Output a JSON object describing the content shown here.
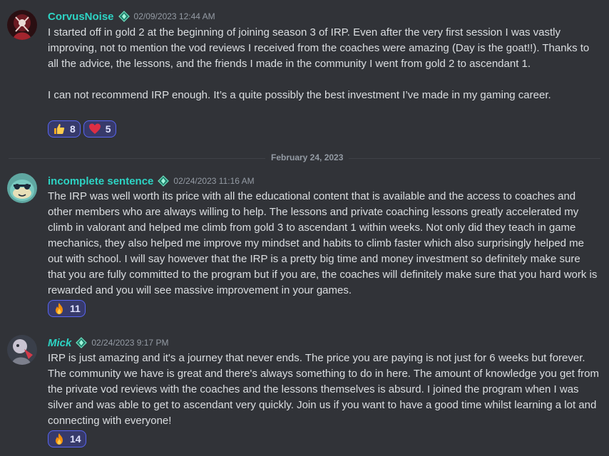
{
  "messages": [
    {
      "username": "CorvusNoise",
      "timestamp": "02/09/2023 12:44 AM",
      "text": "I started off in gold 2 at the beginning of joining season 3 of IRP. Even after the very first session I was vastly improving, not to mention the vod reviews I received from the coaches were amazing (Day is the goat!!). Thanks to all the advice, the lessons, and the friends I made in the community I went from gold 2 to ascendant 1.\n\nI can not recommend IRP enough. It’s a quite possibly the best investment I’ve made in my gaming career.",
      "reactions": [
        {
          "emoji": "thumbs-up",
          "count": "8"
        },
        {
          "emoji": "red-heart",
          "count": "5"
        }
      ]
    },
    {
      "username": "incomplete sentence",
      "timestamp": "02/24/2023 11:16 AM",
      "text": "The IRP was well worth its price with all the educational content that is available and the access to coaches and other members who are always willing to help. The lessons and private coaching lessons greatly accelerated my climb in valorant and helped me climb from gold 3 to ascendant 1 within weeks. Not only did they teach in game mechanics, they also helped me improve my mindset and habits to climb faster which also surprisingly helped me out with school. I will say however that the IRP is a pretty big time and money investment so definitely make sure that you are fully committed to the program but if you are, the coaches will definitely make sure that you hard work is rewarded and you will see massive improvement in your games.",
      "reactions": [
        {
          "emoji": "fire",
          "count": "11"
        }
      ]
    },
    {
      "username": "Mick",
      "timestamp": "02/24/2023 9:17 PM",
      "text": "IRP is just amazing and it's a journey that never ends. The price you are paying is not just for 6 weeks but forever. The community we have is great and there's always something to do in here. The amount of knowledge you get from the private vod reviews with the coaches and the lessons themselves is absurd. I joined the program when I was silver and was able to get to ascendant very quickly. Join us if you want to have a good time whilst learning a lot and connecting with everyone!",
      "reactions": [
        {
          "emoji": "fire",
          "count": "14"
        }
      ]
    }
  ],
  "date_divider": "February 24, 2023",
  "colors": {
    "background": "#313338",
    "username": "#2dd4c4",
    "reaction_border": "#5865f2",
    "reaction_bg": "#373a6b"
  }
}
